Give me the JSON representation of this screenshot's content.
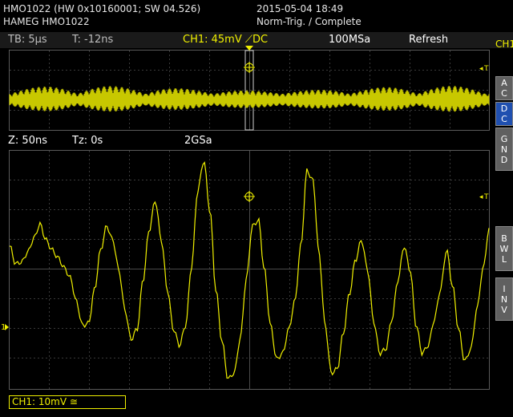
{
  "header": {
    "device_line": "HMO1022 (HW 0x10160001; SW 04.526)",
    "model_line": "HAMEG HMO1022",
    "datetime": "2015-05-04 18:49",
    "trigger_status": "Norm-Trig. / Complete"
  },
  "main_bar": {
    "timebase": "TB: 5µs",
    "trigger_time": "T: -12ns",
    "channel_setting": "CH1: 45mV ⟋DC",
    "sample_rate": "100MSa",
    "mode": "Refresh"
  },
  "zoom_bar": {
    "zoom": "Z: 50ns",
    "zoom_time": "Tz: 0s",
    "sample_rate": "2GSa"
  },
  "side_panel": {
    "channel": [
      "C",
      "H",
      "1"
    ],
    "buttons": [
      {
        "id": "ac",
        "label": [
          "A",
          "C"
        ],
        "active": false
      },
      {
        "id": "dc",
        "label": [
          "D",
          "C"
        ],
        "active": true
      },
      {
        "id": "gnd",
        "label": [
          "G",
          "N",
          "D"
        ],
        "active": false
      },
      {
        "id": "bwl",
        "label": [
          "B",
          "W",
          "L"
        ],
        "active": false
      },
      {
        "id": "inv",
        "label": [
          "I",
          "N",
          "V"
        ],
        "active": false
      }
    ]
  },
  "markers": {
    "trigger_level": "T",
    "channel_ground": "1"
  },
  "status": {
    "ch1_scale": "CH1: 10mV ≅"
  },
  "colors": {
    "trace": "#f0f000",
    "grid": "#3a3a3a",
    "active_button": "#2050b0",
    "button": "#606060"
  },
  "zoom_trace": {
    "y": [
      0.52,
      0.43,
      0.44,
      0.49,
      0.56,
      0.63,
      0.55,
      0.5,
      0.46,
      0.41,
      0.36,
      0.24,
      0.12,
      0.13,
      0.3,
      0.5,
      0.62,
      0.55,
      0.4,
      0.2,
      0.05,
      0.1,
      0.35,
      0.6,
      0.75,
      0.55,
      0.3,
      0.1,
      0.02,
      0.12,
      0.42,
      0.8,
      0.95,
      0.7,
      0.3,
      0.04,
      -0.15,
      -0.12,
      0.05,
      0.35,
      0.62,
      0.65,
      0.4,
      0.12,
      -0.05,
      -0.02,
      0.1,
      0.24,
      0.52,
      0.9,
      0.85,
      0.48,
      0.12,
      -0.12,
      -0.1,
      0.08,
      0.28,
      0.45,
      0.55,
      0.4,
      0.14,
      -0.02,
      0.0,
      0.15,
      0.35,
      0.52,
      0.4,
      0.12,
      -0.02,
      0.02,
      0.15,
      0.3,
      0.5,
      0.32,
      0.1,
      -0.06,
      0.0,
      0.2,
      0.4,
      0.6
    ]
  }
}
